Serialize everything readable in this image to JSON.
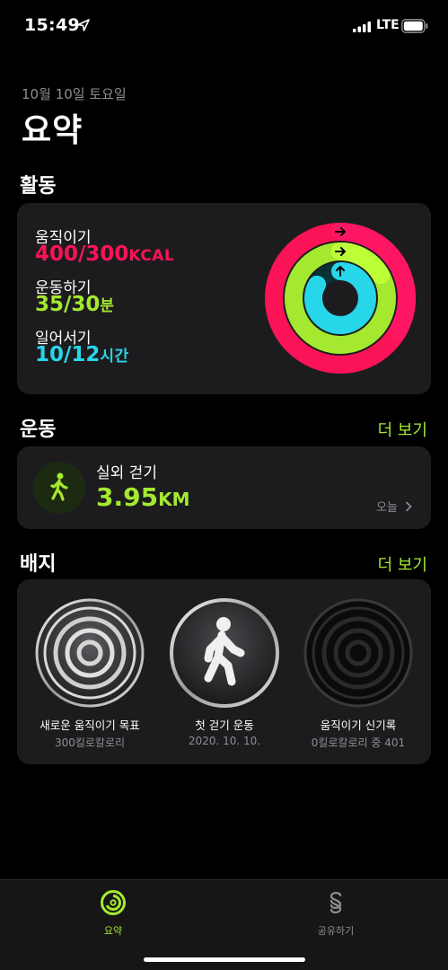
{
  "status_bar": {
    "time": "15:49",
    "network": "LTE"
  },
  "header": {
    "date": "10월 10일 토요일",
    "title": "요약"
  },
  "activity": {
    "section_title": "활동",
    "move": {
      "label": "움직이기",
      "value": "400/300",
      "unit": "KCAL",
      "progress": 1.333,
      "color": "#fa1356"
    },
    "exercise": {
      "label": "운동하기",
      "value": "35/30",
      "unit": "분",
      "progress": 1.167,
      "color": "#a4e930"
    },
    "stand": {
      "label": "일어서기",
      "value": "10/12",
      "unit": "시간",
      "progress": 0.833,
      "color": "#27d6e8"
    }
  },
  "workouts": {
    "section_title": "운동",
    "more_label": "더 보기",
    "item": {
      "name": "실외 걷기",
      "value": "3.95",
      "unit": "KM",
      "date": "오늘",
      "icon": "walking-figure-icon"
    }
  },
  "badges": {
    "section_title": "배지",
    "more_label": "더 보기",
    "items": [
      {
        "title": "새로운 움직이기 목표",
        "subtitle": "300킬로칼로리",
        "icon": "concentric-rings-badge-icon"
      },
      {
        "title": "첫 걷기 운동",
        "subtitle": "2020. 10. 10.",
        "icon": "walking-badge-icon"
      },
      {
        "title": "움직이기 신기록",
        "subtitle": "0킬로칼로리 중 401",
        "icon": "locked-rings-badge-icon"
      }
    ]
  },
  "tab_bar": {
    "tabs": [
      {
        "label": "요약",
        "icon": "activity-rings-icon",
        "active": true,
        "color": "#a4e930"
      },
      {
        "label": "공유하기",
        "icon": "sharing-icon",
        "active": false,
        "color": "#8e8e93"
      }
    ]
  }
}
